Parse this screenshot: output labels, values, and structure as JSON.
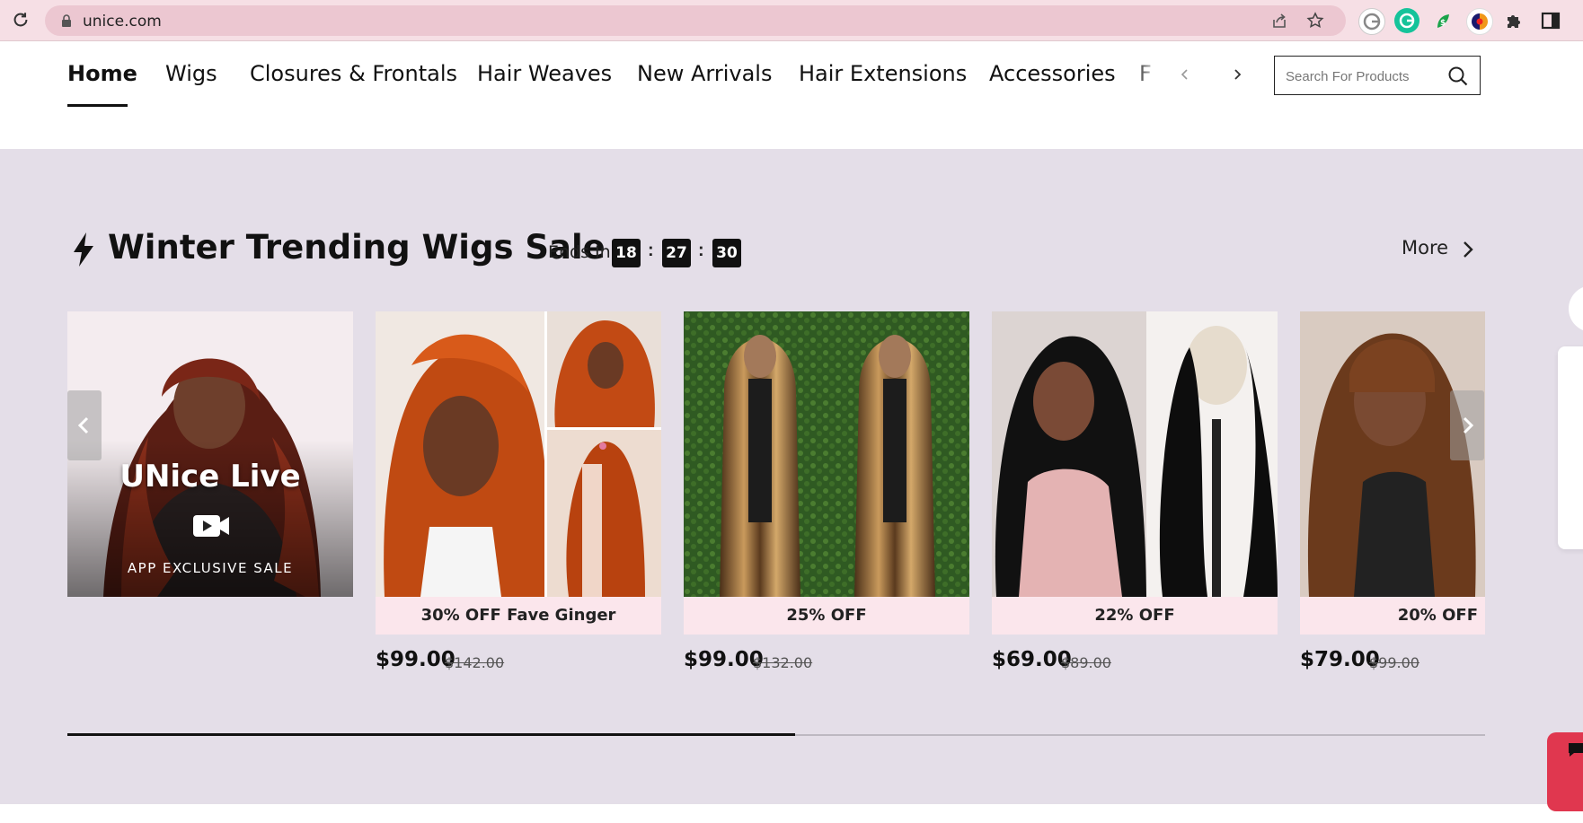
{
  "browser": {
    "url": "unice.com",
    "icons": [
      "reload-icon",
      "lock-icon",
      "share-icon",
      "bookmark-star-icon",
      "extension-g-icon",
      "extension-grammarly-icon",
      "extension-leaf-icon",
      "extension-color-icon",
      "puzzle-icon",
      "sidebar-icon"
    ]
  },
  "nav": {
    "items": [
      "Home",
      "Wigs",
      "Closures & Frontals",
      "Hair Weaves",
      "New Arrivals",
      "Hair Extensions",
      "Accessories",
      "F"
    ],
    "active": "Home",
    "search_placeholder": "Search For Products"
  },
  "sale": {
    "title": "Winter Trending Wigs Sale",
    "ends_label": "Ends In",
    "timer": {
      "hours": "18",
      "minutes": "27",
      "seconds": "30"
    },
    "more_label": "More",
    "live": {
      "title": "UNice Live",
      "subtitle": "APP EXCLUSIVE SALE"
    },
    "products": [
      {
        "badge": "30% OFF   Fave Ginger",
        "price": "$99.00",
        "old_price": "$142.00"
      },
      {
        "badge": "25% OFF",
        "price": "$99.00",
        "old_price": "$132.00"
      },
      {
        "badge": "22% OFF",
        "price": "$69.00",
        "old_price": "$89.00"
      },
      {
        "badge": "20% OFF",
        "price": "$79.00",
        "old_price": "$99.00"
      }
    ],
    "progress_fraction": 0.513
  },
  "colors": {
    "chrome_bg": "#f6dfe5",
    "section_bg": "#e4dee8",
    "badge_bg": "#fbe6ec",
    "help_red": "#e0374f"
  }
}
